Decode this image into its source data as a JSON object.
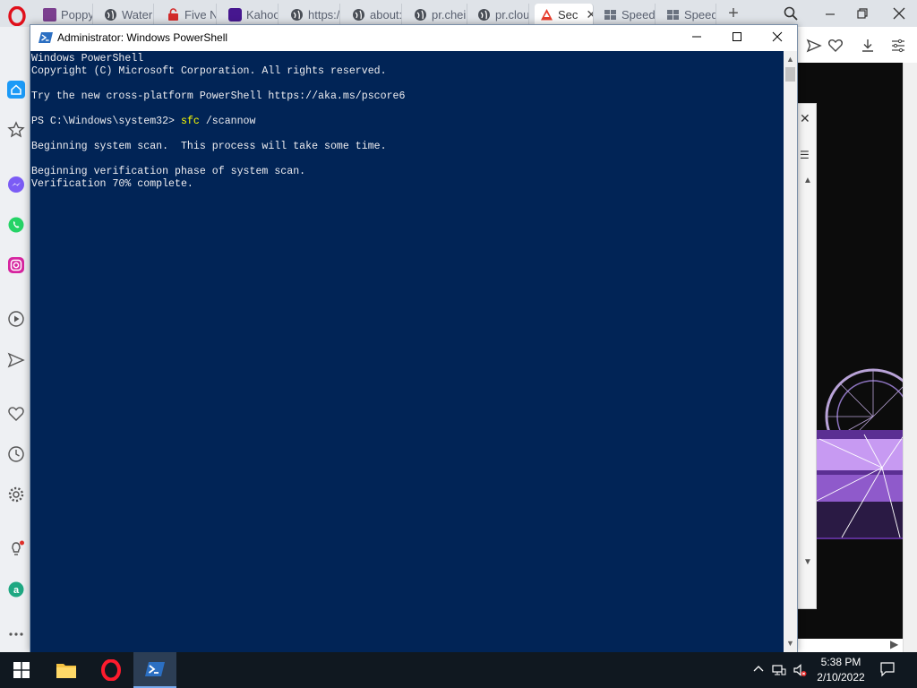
{
  "browser": {
    "tabs": [
      {
        "label": "Poppy"
      },
      {
        "label": "Water"
      },
      {
        "label": "Five N"
      },
      {
        "label": "Kahoo"
      },
      {
        "label": "https:/"
      },
      {
        "label": "about:"
      },
      {
        "label": "pr.chei"
      },
      {
        "label": "pr.clou"
      },
      {
        "label": "Sec"
      },
      {
        "label": "Speed"
      },
      {
        "label": "Speed"
      }
    ],
    "new_tab": "+"
  },
  "powershell": {
    "title": "Administrator: Windows PowerShell",
    "console": {
      "line1": "Windows PowerShell",
      "line2": "Copyright (C) Microsoft Corporation. All rights reserved.",
      "line3": "",
      "line4": "Try the new cross-platform PowerShell https://aka.ms/pscore6",
      "line5": "",
      "prompt": "PS C:\\Windows\\system32> ",
      "command": "sfc",
      "command_args": " /scannow",
      "line7": "",
      "line8": "Beginning system scan.  This process will take some time.",
      "line9": "",
      "line10": "Beginning verification phase of system scan.",
      "line11": "Verification 70% complete."
    },
    "verification_progress_percent": 70
  },
  "taskbar": {
    "time": "5:38 PM",
    "date": "2/10/2022"
  },
  "colors": {
    "console_bg": "#012456",
    "console_text": "#eeedf0",
    "command_highlight": "#ffff00",
    "taskbar_bg": "#101820"
  }
}
